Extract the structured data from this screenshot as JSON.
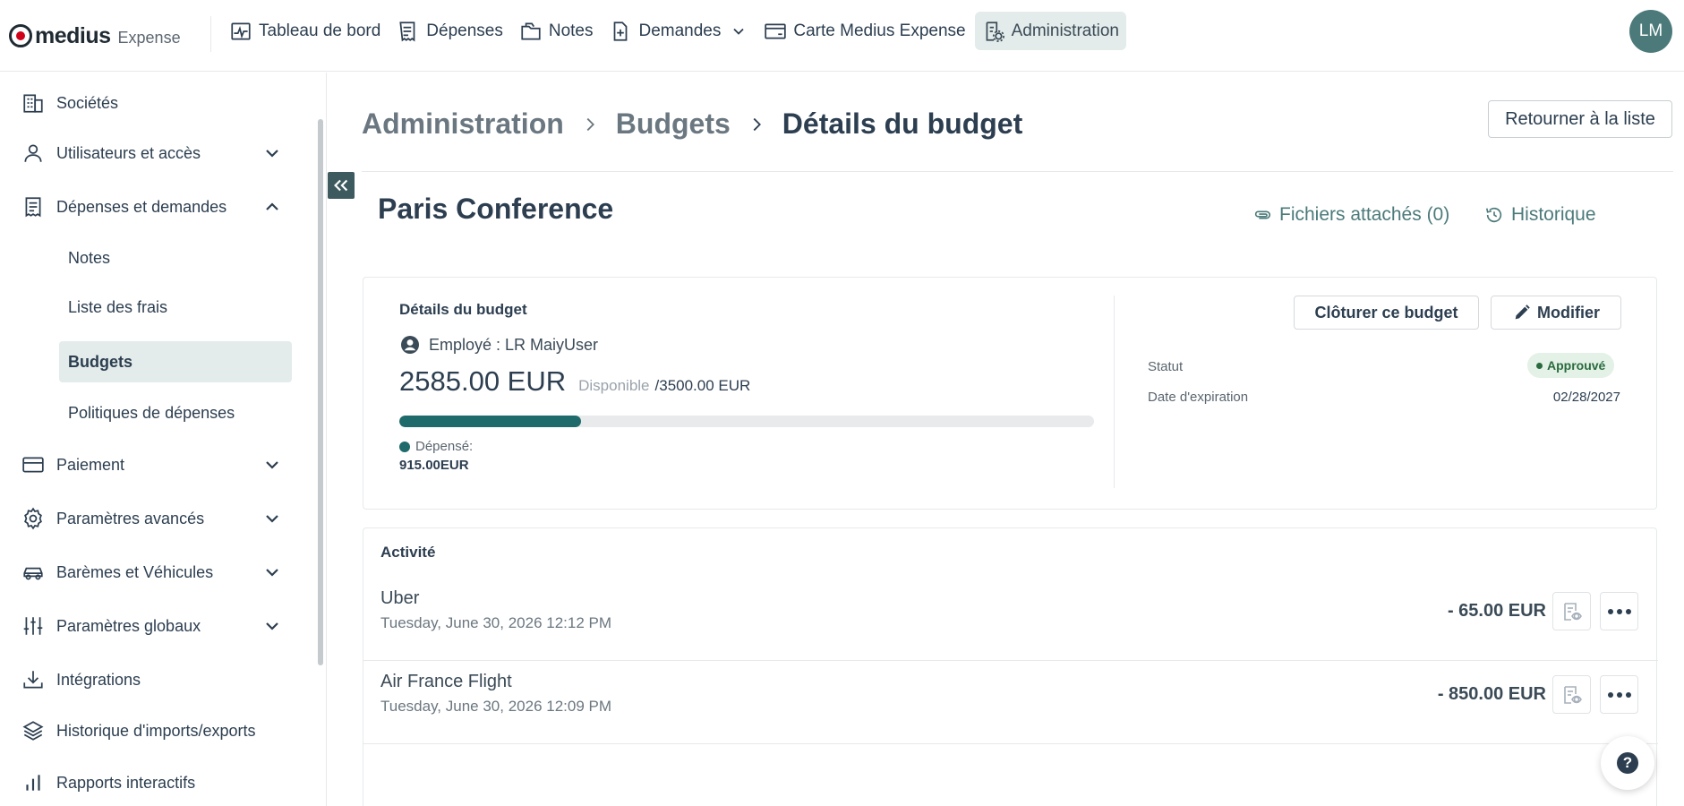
{
  "app": {
    "logo_text": "medius",
    "logo_sub": "Expense"
  },
  "topnav": {
    "items": [
      {
        "label": "Tableau de bord",
        "icon": "dashboard-icon"
      },
      {
        "label": "Dépenses",
        "icon": "receipt-icon"
      },
      {
        "label": "Notes",
        "icon": "folder-icon"
      },
      {
        "label": "Demandes",
        "icon": "document-plus-icon"
      },
      {
        "label": "Carte Medius Expense",
        "icon": "card-icon"
      },
      {
        "label": "Administration",
        "icon": "admin-icon"
      }
    ],
    "active": "Administration",
    "avatar_initials": "LM"
  },
  "sidebar": {
    "items": [
      {
        "label": "Sociétés"
      },
      {
        "label": "Utilisateurs et accès"
      },
      {
        "label": "Dépenses et demandes"
      },
      {
        "label": "Paiement"
      },
      {
        "label": "Paramètres avancés"
      },
      {
        "label": "Barèmes et Véhicules"
      },
      {
        "label": "Paramètres globaux"
      },
      {
        "label": "Intégrations"
      },
      {
        "label": "Historique d'imports/exports"
      },
      {
        "label": "Rapports interactifs"
      }
    ],
    "subitems": [
      {
        "label": "Notes"
      },
      {
        "label": "Liste des frais"
      },
      {
        "label": "Budgets"
      },
      {
        "label": "Politiques de dépenses"
      }
    ]
  },
  "breadcrumb": {
    "root": "Administration",
    "section": "Budgets",
    "current": "Détails du budget"
  },
  "actions": {
    "return_label": "Retourner à la liste"
  },
  "budget": {
    "title": "Paris Conference",
    "attachments_label": "Fichiers attachés (0)",
    "history_label": "Historique",
    "card_title": "Détails du budget",
    "employee": "Employé : LR MaiyUser",
    "available_amount": "2585.00 EUR",
    "available_label": "Disponible",
    "total": "/3500.00 EUR",
    "spent_label": "Dépensé:",
    "spent_value": "915.00EUR",
    "spent_fraction": 0.2614,
    "close_label": "Clôturer ce budget",
    "edit_label": "Modifier",
    "status_label": "Statut",
    "status_value": "Approuvé",
    "expiry_label": "Date d'expiration",
    "expiry_value": "02/28/2027"
  },
  "colors": {
    "accent": "#1f6a6a",
    "active_bg": "#e3ecea",
    "status_green": "#2a6b3d"
  },
  "activity": {
    "title": "Activité",
    "rows": [
      {
        "name": "Uber",
        "date": "Tuesday, June 30, 2026 12:12 PM",
        "amount": "- 65.00 EUR"
      },
      {
        "name": "Air France Flight",
        "date": "Tuesday, June 30, 2026 12:09 PM",
        "amount": "- 850.00 EUR"
      }
    ]
  }
}
